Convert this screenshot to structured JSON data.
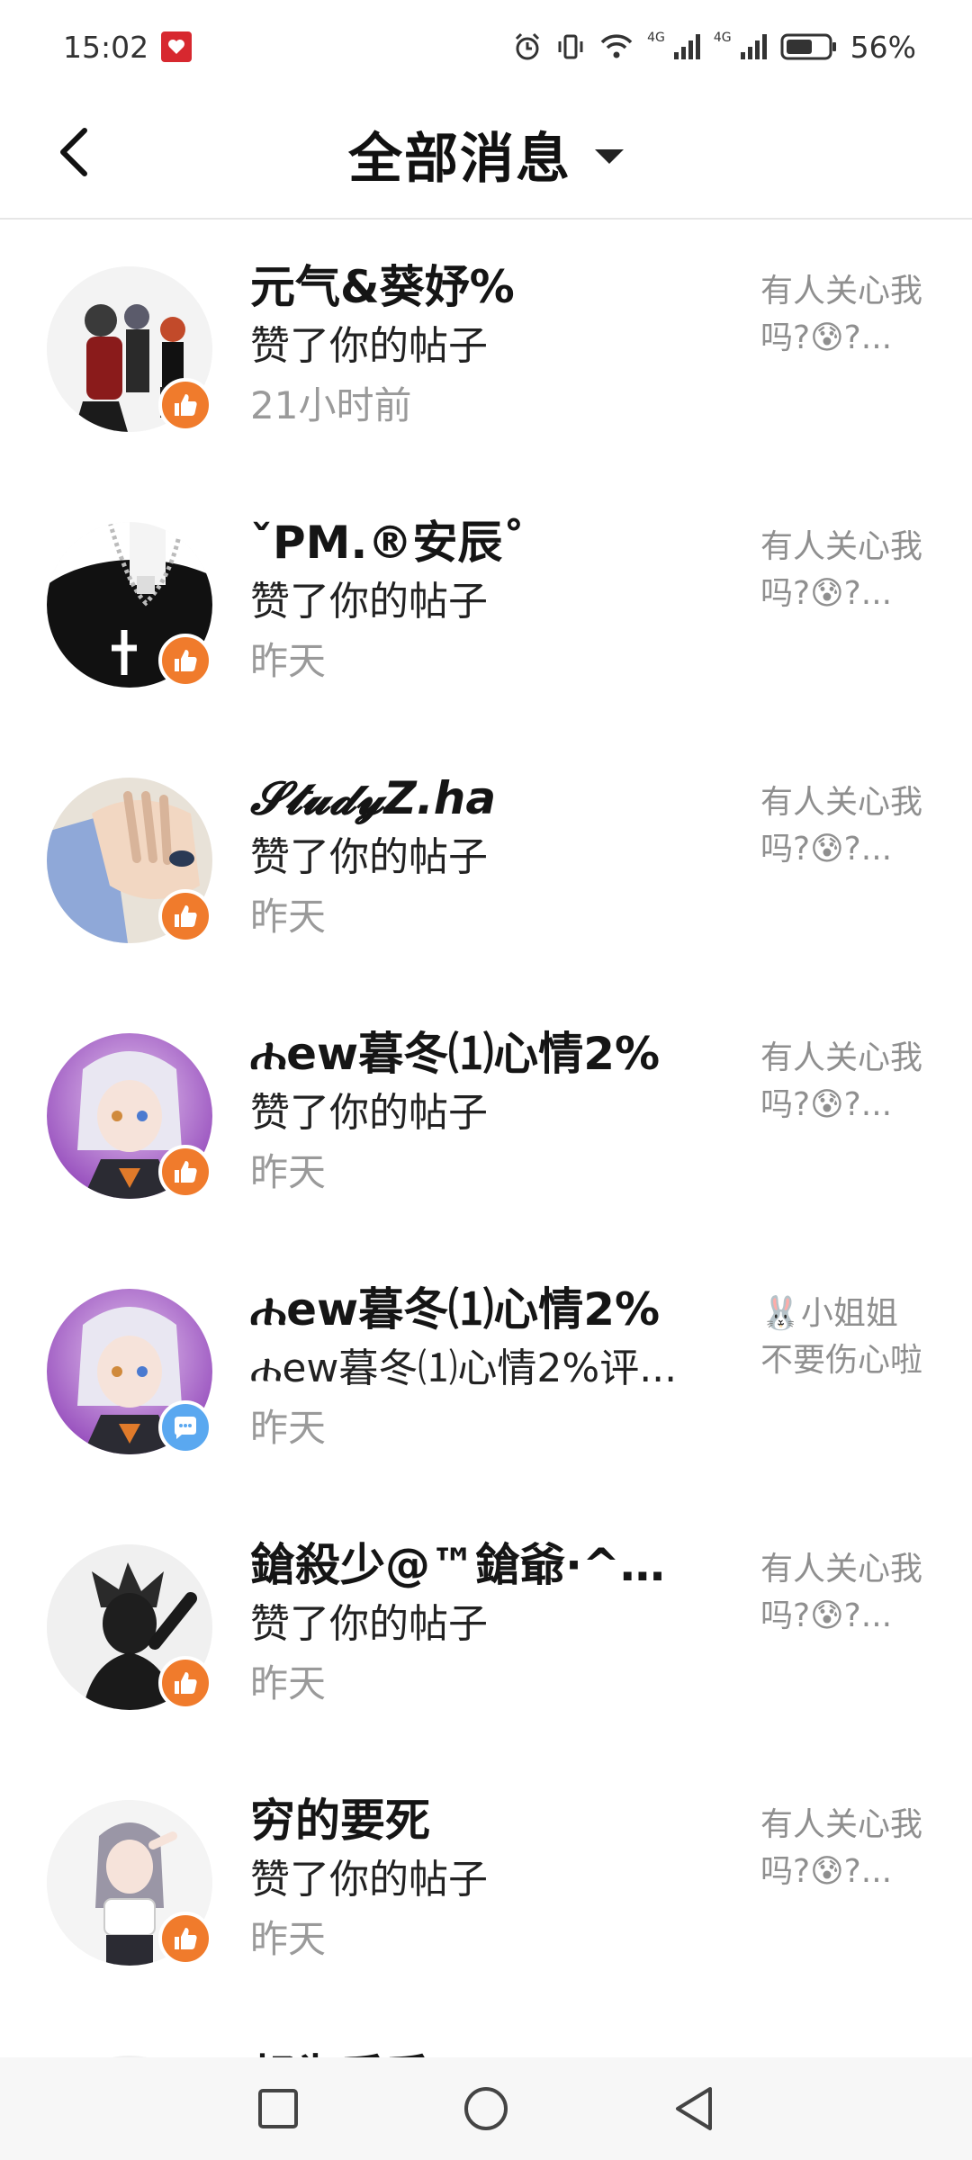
{
  "status_bar": {
    "time": "15:02",
    "network_left": "4G",
    "network_right": "4G",
    "battery": "56%",
    "accent": "#d7282f"
  },
  "header": {
    "title": "全部消息"
  },
  "messages": [
    {
      "name": "元气&葵妤%",
      "action": "赞了你的帖子",
      "time": "21小时前",
      "preview": "有人关心我吗?😰?...",
      "type": "like"
    },
    {
      "name": "ˇPM.®安辰˚",
      "action": "赞了你的帖子",
      "time": "昨天",
      "preview": "有人关心我吗?😰?...",
      "type": "like"
    },
    {
      "name": "𝓢𝓽𝓾𝓭𝔂Z.ha",
      "action": "赞了你的帖子",
      "time": "昨天",
      "preview": "有人关心我吗?😰?...",
      "type": "like"
    },
    {
      "name": "ሐew暮冬⑴心情2%",
      "action": "赞了你的帖子",
      "time": "昨天",
      "preview": "有人关心我吗?😰?...",
      "type": "like"
    },
    {
      "name": "ሐew暮冬⑴心情2%",
      "action": "ሐew暮冬⑴心情2%评...",
      "time": "昨天",
      "preview": "🐰小姐姐不要伤心啦",
      "type": "comment"
    },
    {
      "name": "鎗殺少@™鎗爺·^『...",
      "action": "赞了你的帖子",
      "time": "昨天",
      "preview": "有人关心我吗?😰?...",
      "type": "like"
    },
    {
      "name": "穷的要死",
      "action": "赞了你的帖子",
      "time": "昨天",
      "preview": "有人关心我吗?😰?...",
      "type": "like"
    },
    {
      "name": "叔为乎乎",
      "action": "",
      "time": "",
      "preview": "",
      "type": "like"
    }
  ],
  "colors": {
    "like_badge": "#f07b2c",
    "comment_badge": "#5aa8f0"
  }
}
